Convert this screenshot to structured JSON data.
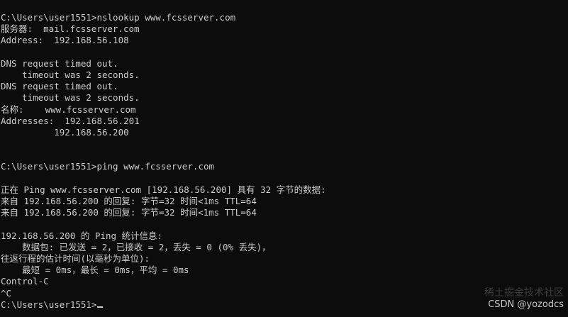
{
  "app": {
    "type": "Command Prompt"
  },
  "console": {
    "background": "#0c0c0c",
    "foreground": "#cccccc",
    "lines": [
      "C:\\Users\\user1551>nslookup www.fcsserver.com",
      "服务器:  mail.fcsserver.com",
      "Address:  192.168.56.108",
      "",
      "DNS request timed out.",
      "    timeout was 2 seconds.",
      "DNS request timed out.",
      "    timeout was 2 seconds.",
      "名称:    www.fcsserver.com",
      "Addresses:  192.168.56.201",
      "          192.168.56.200",
      "",
      "",
      "C:\\Users\\user1551>ping www.fcsserver.com",
      "",
      "正在 Ping www.fcsserver.com [192.168.56.200] 具有 32 字节的数据:",
      "来自 192.168.56.200 的回复: 字节=32 时间<1ms TTL=64",
      "来自 192.168.56.200 的回复: 字节=32 时间<1ms TTL=64",
      "",
      "192.168.56.200 的 Ping 统计信息:",
      "    数据包: 已发送 = 2，已接收 = 2，丢失 = 0 (0% 丢失)，",
      "往返行程的估计时间(以毫秒为单位):",
      "    最短 = 0ms，最长 = 0ms，平均 = 0ms",
      "Control-C",
      "^C"
    ],
    "prompt": "C:\\Users\\user1551>"
  },
  "watermark": {
    "faint_text": "稀土掘金技术社区",
    "text": "CSDN @yozodcs"
  }
}
